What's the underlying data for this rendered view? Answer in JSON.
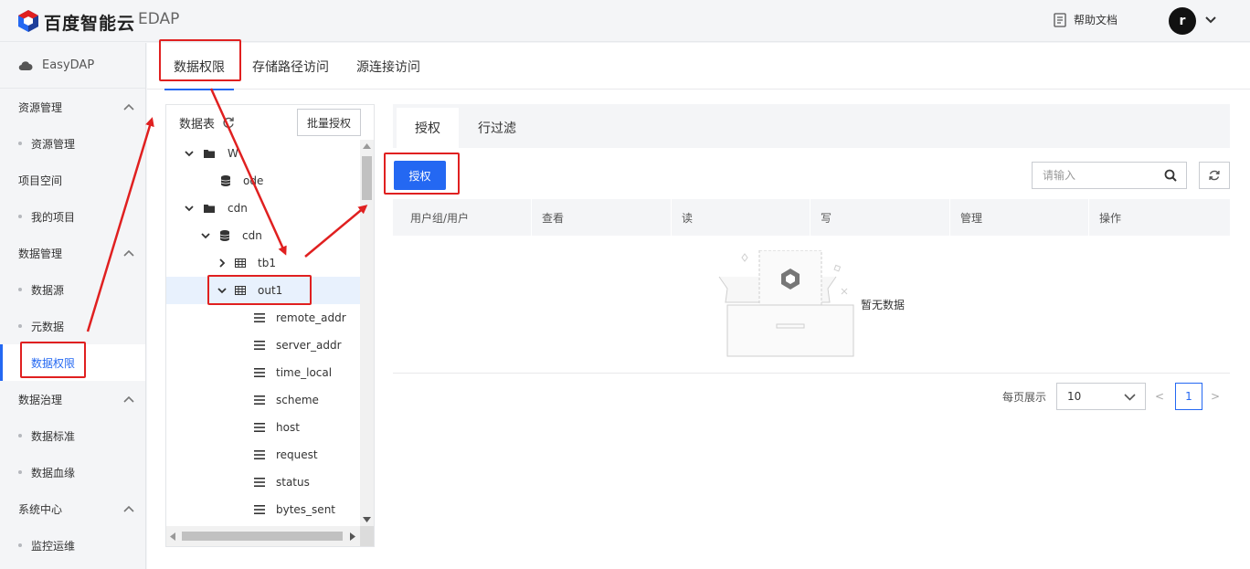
{
  "header": {
    "brand": "百度智能云",
    "product": "EDAP",
    "help_label": "帮助文档",
    "avatar_letter": "r"
  },
  "sidebar": {
    "app_name": "EasyDAP",
    "groups": [
      {
        "label": "资源管理",
        "items": [
          "资源管理"
        ]
      },
      {
        "label": "项目空间",
        "items": [
          "我的项目"
        ]
      },
      {
        "label": "数据管理",
        "items": [
          "数据源",
          "元数据",
          "数据权限"
        ]
      },
      {
        "label": "数据治理",
        "items": [
          "数据标准",
          "数据血缘"
        ]
      },
      {
        "label": "系统中心",
        "items": [
          "监控运维"
        ]
      }
    ],
    "active_item": "数据权限"
  },
  "tabs": [
    "数据权限",
    "存储路径访问",
    "源连接访问"
  ],
  "tree": {
    "title": "数据表",
    "batch_button": "批量授权",
    "nodes": [
      {
        "label": "W",
        "type": "folder"
      },
      {
        "label": "ode",
        "type": "database"
      },
      {
        "label": "cdn",
        "type": "folder"
      },
      {
        "label": "cdn",
        "type": "database"
      },
      {
        "label": "tb1",
        "type": "table"
      },
      {
        "label": "out1",
        "type": "table",
        "selected": true
      },
      {
        "label": "remote_addr",
        "type": "column"
      },
      {
        "label": "server_addr",
        "type": "column"
      },
      {
        "label": "time_local",
        "type": "column"
      },
      {
        "label": "scheme",
        "type": "column"
      },
      {
        "label": "host",
        "type": "column"
      },
      {
        "label": "request",
        "type": "column"
      },
      {
        "label": "status",
        "type": "column"
      },
      {
        "label": "bytes_sent",
        "type": "column"
      }
    ]
  },
  "panel": {
    "subtabs": [
      "授权",
      "行过滤"
    ],
    "auth_button": "授权",
    "search_placeholder": "请输入",
    "columns": [
      "用户组/用户",
      "查看",
      "读",
      "写",
      "管理",
      "操作"
    ],
    "empty_text": "暂无数据",
    "pagination": {
      "per_page_label": "每页展示",
      "page_size": "10",
      "current_page": "1",
      "prev": "<",
      "next": ">"
    }
  },
  "colors": {
    "accent": "#2468f2",
    "annotation": "#e02020"
  }
}
